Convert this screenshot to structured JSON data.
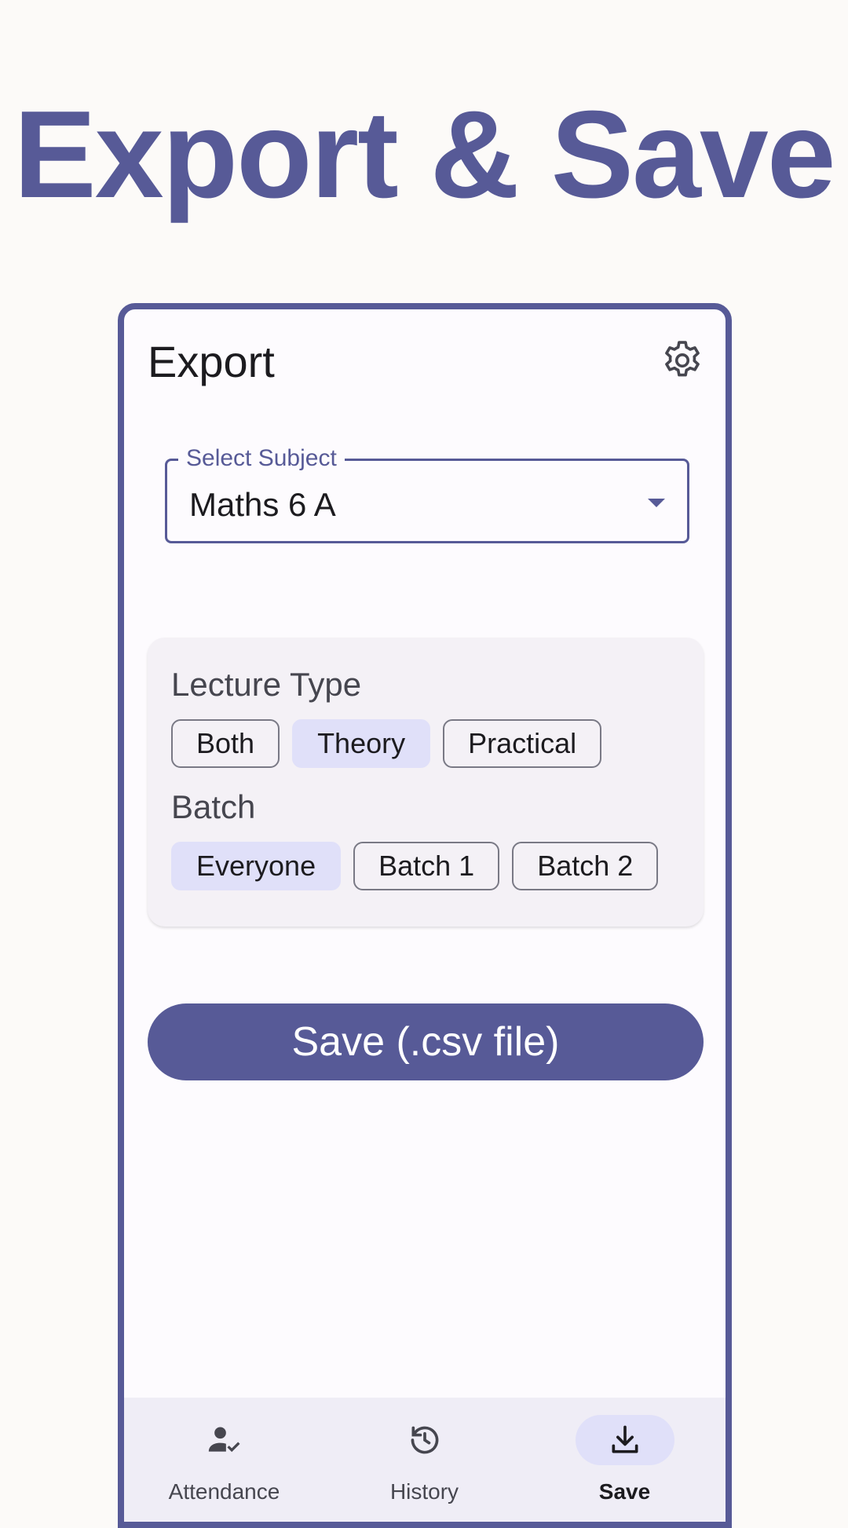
{
  "headline": "Export & Save",
  "app": {
    "title": "Export",
    "settings_icon": "gear-icon"
  },
  "subject_field": {
    "label": "Select Subject",
    "value": "Maths 6 A"
  },
  "filters": {
    "lecture_type": {
      "label": "Lecture Type",
      "options": [
        "Both",
        "Theory",
        "Practical"
      ],
      "selected": "Theory"
    },
    "batch": {
      "label": "Batch",
      "options": [
        "Everyone",
        "Batch 1",
        "Batch 2"
      ],
      "selected": "Everyone"
    }
  },
  "save_button": {
    "label": "Save (.csv file)"
  },
  "nav": {
    "items": [
      {
        "label": "Attendance",
        "icon": "person-check-icon"
      },
      {
        "label": "History",
        "icon": "history-icon"
      },
      {
        "label": "Save",
        "icon": "download-icon"
      }
    ],
    "active": "Save"
  },
  "colors": {
    "primary": "#575a97",
    "chip_selected": "#e0e0f9",
    "card": "#f4f1f6",
    "navbar": "#efedf6"
  }
}
